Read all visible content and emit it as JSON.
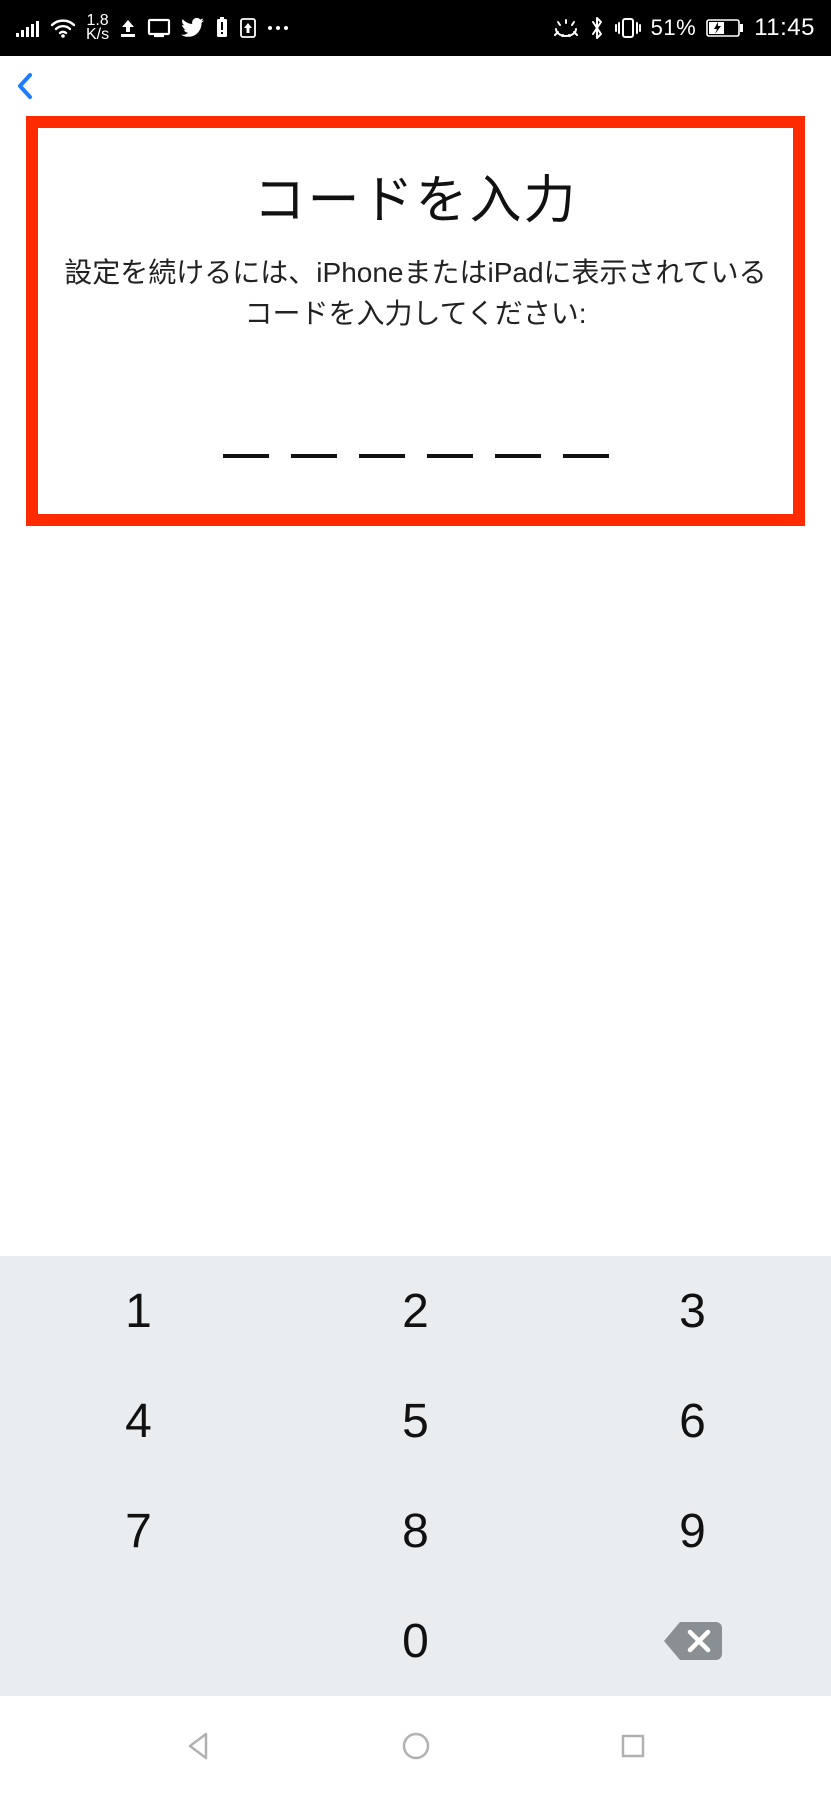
{
  "statusbar": {
    "speed_value": "1.8",
    "speed_unit": "K/s",
    "battery_pct": "51%",
    "clock": "11:45"
  },
  "panel": {
    "title": "コードを入力",
    "subtitle": "設定を続けるには、iPhoneまたはiPadに表示されているコードを入力してください:",
    "slot_count": 6
  },
  "keypad": {
    "keys": [
      "1",
      "2",
      "3",
      "4",
      "5",
      "6",
      "7",
      "8",
      "9",
      "",
      "0",
      "⌫"
    ]
  }
}
